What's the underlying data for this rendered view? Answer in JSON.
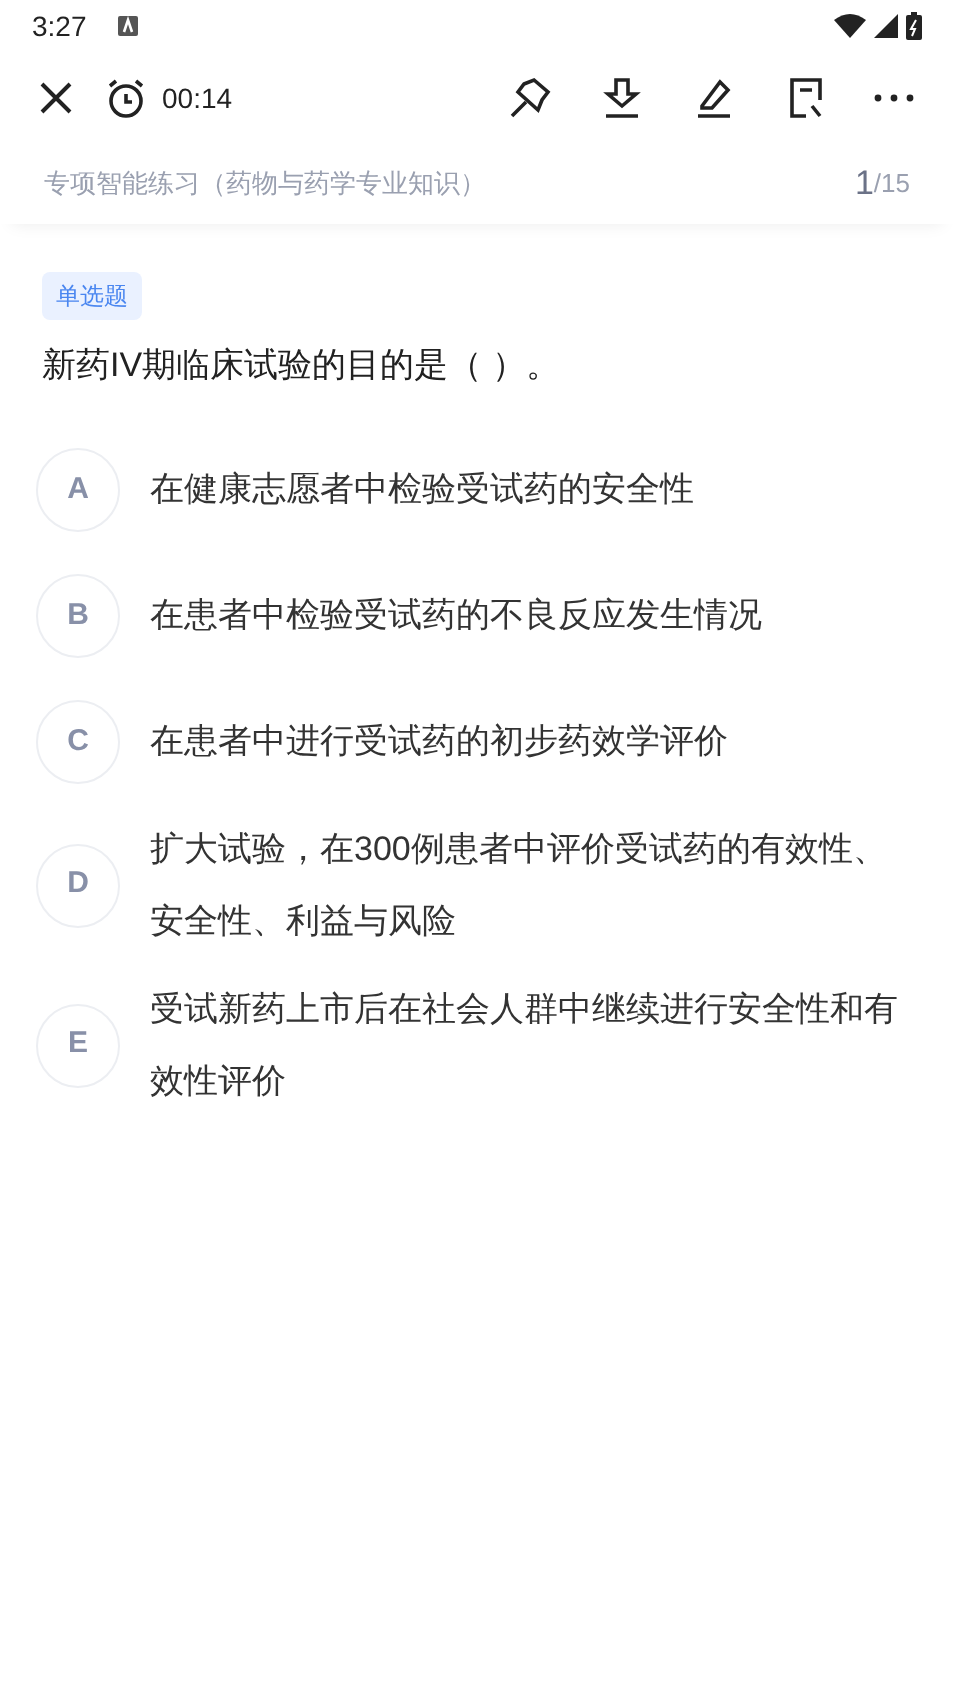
{
  "status_bar": {
    "time": "3:27"
  },
  "toolbar": {
    "timer": "00:14"
  },
  "header": {
    "title": "专项智能练习（药物与药学专业知识）",
    "current": "1",
    "total": "/15"
  },
  "question": {
    "type_tag": "单选题",
    "text": "新药IV期临床试验的目的是（ ）。"
  },
  "options": [
    {
      "letter": "A",
      "text": "在健康志愿者中检验受试药的安全性",
      "selected": false
    },
    {
      "letter": "B",
      "text": "在患者中检验受试药的不良反应发生情况",
      "selected": false
    },
    {
      "letter": "C",
      "text": "在患者中进行受试药的初步药效学评价",
      "selected": false
    },
    {
      "letter": "D",
      "text": "扩大试验，在300例患者中评价受试药的有效性、安全性、利益与风险",
      "selected": false
    },
    {
      "letter": "E",
      "text": "受试新药上市后在社会人群中继续进行安全性和有效性评价",
      "selected": false
    }
  ]
}
